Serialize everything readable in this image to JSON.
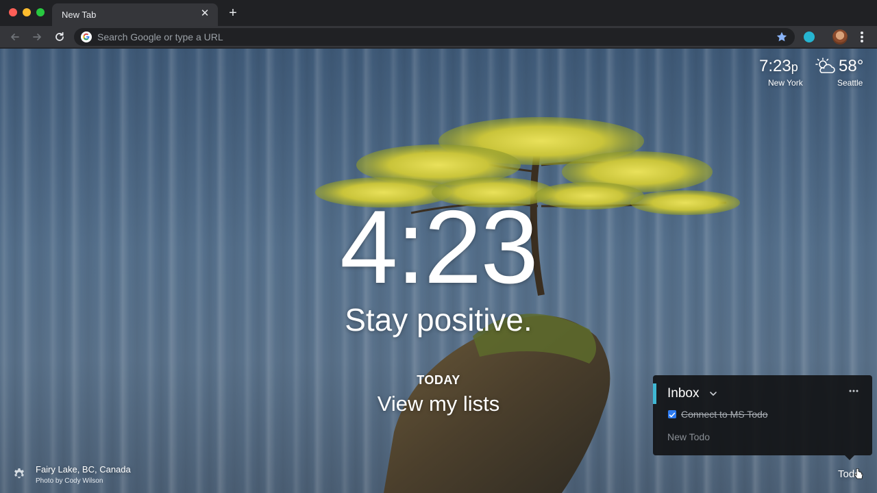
{
  "browser": {
    "tab_title": "New Tab",
    "tab_close": "✕",
    "new_tab": "+",
    "omnibox_placeholder": "Search Google or type a URL"
  },
  "widgets": {
    "clock_time": "7:23",
    "clock_ampm": "p",
    "clock_city": "New York",
    "temperature": "58°",
    "weather_city": "Seattle",
    "weather_icon": "partly-cloudy-icon"
  },
  "center": {
    "time": "4:23",
    "mantra": "Stay positive.",
    "today_label": "TODAY",
    "focus_text": "View my lists"
  },
  "footer": {
    "location": "Fairy Lake, BC, Canada",
    "credit": "Photo by Cody Wilson",
    "todo_label": "Todo"
  },
  "todo": {
    "list_title": "Inbox",
    "items": [
      {
        "text": "Connect to MS Todo",
        "done": true
      }
    ],
    "new_placeholder": "New Todo"
  },
  "colors": {
    "accent": "#3fb8d4",
    "checkbox": "#2d7bf0",
    "extension": "#26b5d1",
    "star": "#8ab4f8"
  }
}
